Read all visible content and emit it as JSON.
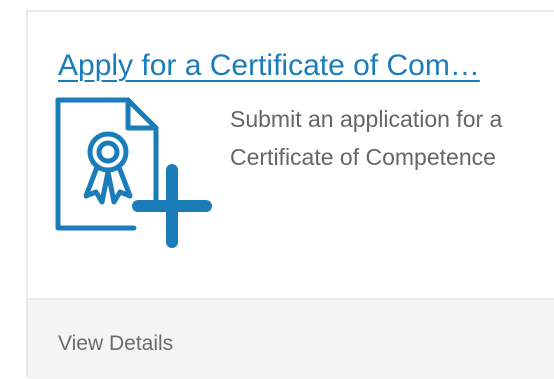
{
  "card": {
    "title": "Apply for a Certificate of Com…",
    "description": "Submit an application for a Certificate of Competence",
    "icon": "certificate-add-icon",
    "footer_label": "View Details"
  },
  "colors": {
    "link": "#1a7dba",
    "icon": "#1a7dba",
    "text": "#666666",
    "footer_bg": "#f5f5f5",
    "border": "#e6e9eb"
  }
}
